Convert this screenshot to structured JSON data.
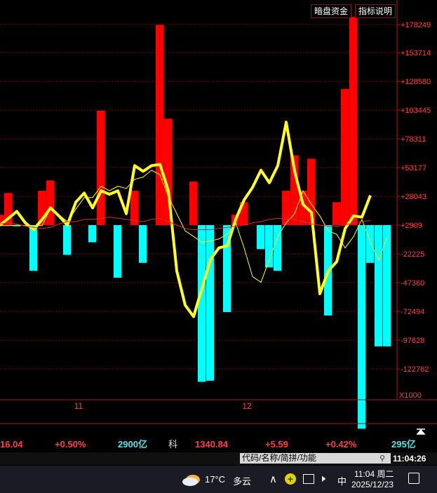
{
  "header": {
    "dark_pool_button": "暗盘资金",
    "indicator_button": "指标说明"
  },
  "y_axis": {
    "ticks": [
      "178249",
      "153714",
      "128580",
      "103445",
      "78311",
      "53177",
      "28043",
      "2909",
      "-22225",
      "-47360",
      "-72494",
      "-97628",
      "-122762"
    ],
    "unit": "X1000"
  },
  "x_axis": {
    "labels": [
      "11",
      "12"
    ]
  },
  "chart_data": {
    "type": "bar",
    "ylim": [
      -147896,
      190000
    ],
    "bars_x": [
      0,
      1,
      2,
      3,
      4,
      5,
      6,
      7,
      8,
      9,
      10,
      11,
      12,
      13,
      14,
      15,
      16,
      17,
      18,
      19,
      20,
      21,
      22,
      23,
      24,
      25,
      26,
      27,
      28,
      29,
      30,
      31,
      32,
      33,
      34,
      35,
      36,
      37,
      38,
      39,
      40,
      41,
      42,
      43,
      44
    ],
    "bars_y": [
      9000,
      28000,
      -1000,
      0,
      -40000,
      30000,
      39000,
      0,
      -26000,
      0,
      0,
      -15000,
      100000,
      0,
      -46000,
      0,
      30000,
      -33000,
      0,
      175000,
      93000,
      0,
      0,
      38000,
      -137000,
      -136000,
      0,
      -76000,
      9000,
      20000,
      0,
      -21000,
      -37000,
      -40000,
      30000,
      61000,
      30000,
      58000,
      0,
      -79000,
      20000,
      119000,
      182000,
      -178000,
      -33000,
      -106000,
      -106000,
      0,
      14000,
      -69000,
      0,
      16000,
      32000,
      16000,
      0
    ],
    "series": [
      {
        "values": [
          0,
          6000,
          12000,
          2000,
          -4000,
          5000,
          15000,
          8000,
          0,
          20000,
          28000,
          15000,
          30000,
          27000,
          30000,
          10000,
          52000,
          47000,
          52000,
          53000,
          30000,
          -40000,
          -70000,
          -80000,
          -55000,
          -30000,
          -20000,
          -18000,
          5000,
          22000,
          33000,
          48000,
          37000,
          52000,
          90000,
          47000,
          18000,
          11000,
          -60000,
          -40000,
          -32000,
          -3000,
          8000,
          7000,
          26000
        ]
      },
      {
        "values": [
          -500,
          -500,
          0,
          -500,
          -500,
          -500,
          15000,
          9000,
          3000,
          14000,
          24000,
          24000,
          34000,
          30000,
          34000,
          32000,
          40000,
          42000,
          48000,
          44000,
          25000,
          10000,
          -5000,
          -10000,
          -15000,
          -14000,
          -12000,
          -8000,
          2000,
          -20000,
          -45000,
          -50000,
          -30000,
          -10000,
          2000,
          10000,
          30000,
          18000,
          8000,
          -5000,
          -8000,
          -20000,
          -10000,
          5000,
          -15000,
          -31000,
          -10000
        ]
      },
      {
        "values": [
          1000,
          2000,
          1000,
          -1000,
          -2000,
          -3000,
          -2000,
          1000,
          3000,
          3000,
          5000,
          5000,
          6000,
          7000,
          6000,
          5000,
          4000,
          3000,
          5000,
          6000,
          3000,
          0,
          -3000,
          -4000,
          -4000,
          -4000,
          -3000,
          -2000,
          -1000,
          0,
          2000,
          3000,
          5000,
          6000,
          5000,
          5000,
          3000,
          1000,
          0,
          -1000,
          -1000,
          0,
          2000,
          3000,
          4000
        ]
      }
    ]
  },
  "ticker": {
    "v1": "16.04",
    "pct1": "+0.50%",
    "amt1": "2900亿",
    "name": "科",
    "price": "1340.84",
    "chg": "+5.59",
    "pct2": "+0.42%",
    "amt2": "295亿"
  },
  "search": {
    "placeholder": "代码/名称/简拼/功能"
  },
  "clock": "11:04:26",
  "taskbar": {
    "temp": "17°C",
    "weather": "多云",
    "ime": "中",
    "time": "11:04 周二",
    "date": "2025/12/23"
  }
}
